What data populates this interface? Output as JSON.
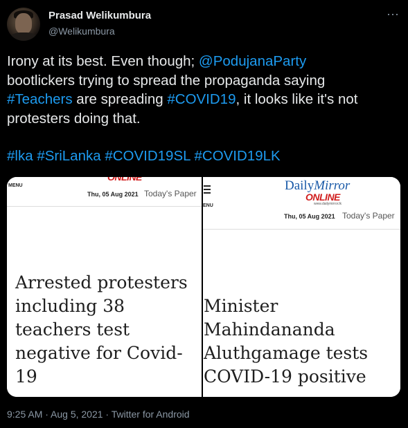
{
  "tweet": {
    "display_name": "Prasad Welikumbura",
    "handle": "@Welikumbura",
    "more_icon": "more-horizontal-icon",
    "text_lines": {
      "l1a": "Irony at its best. Even though; ",
      "l1link": "@PodujanaParty",
      "l2": "bootlickers trying to spread the propaganda saying",
      "l3link": "#Teachers",
      "l3b": " are spreading ",
      "l3link2": "#COVID19",
      "l3c": ", it looks like it's not",
      "l4": "protesters doing that."
    },
    "hashtags": [
      "#lka",
      "#SriLanka",
      "#COVID19SL",
      "#COVID19LK"
    ],
    "timestamp": "9:25 AM · Aug 5, 2021 · Twitter for Android"
  },
  "media": {
    "left": {
      "menu_label": "MENU",
      "logo_partial": "ONLINE",
      "date": "Thu, 05 Aug 2021",
      "todays_paper": "Today's Paper",
      "headline": "Arrested protesters including 38 teachers test negative for Covid-19"
    },
    "right": {
      "menu_label": "ENU",
      "logo_daily": "Daily",
      "logo_mirror": "Mirror",
      "logo_online": "ONLINE",
      "logo_url": "www.dailymirror.lk",
      "date": "Thu, 05 Aug 2021",
      "todays_paper": "Today's Paper",
      "headline": "Minister Mahindananda Aluthgamage tests COVID-19 positive"
    }
  },
  "colors": {
    "background": "#000000",
    "link": "#1d9bf0",
    "text": "#e7e9ea",
    "muted": "#8b98a5",
    "brand_blue": "#1a5aa8",
    "brand_red": "#d01d1d"
  }
}
